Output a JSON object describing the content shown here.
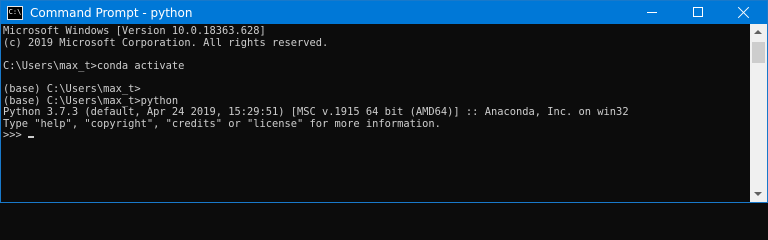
{
  "window": {
    "title": "Command Prompt - python",
    "icon": "cmd-icon",
    "icon_text": "C:\\",
    "controls": [
      "minimize-icon",
      "maximize-icon",
      "close-icon"
    ]
  },
  "console": {
    "lines": [
      "Microsoft Windows [Version 10.0.18363.628]",
      "(c) 2019 Microsoft Corporation. All rights reserved.",
      "",
      "C:\\Users\\max_t>conda activate",
      "",
      "(base) C:\\Users\\max_t>",
      "(base) C:\\Users\\max_t>python",
      "Python 3.7.3 (default, Apr 24 2019, 15:29:51) [MSC v.1915 64 bit (AMD64)] :: Anaconda, Inc. on win32",
      "Type \"help\", \"copyright\", \"credits\" or \"license\" for more information.",
      ">>> "
    ]
  },
  "colors": {
    "titlebar": "#0078d7",
    "console_bg": "#0c0c0c",
    "console_text": "#cccccc",
    "scrollbar": "#f0f0f0"
  }
}
